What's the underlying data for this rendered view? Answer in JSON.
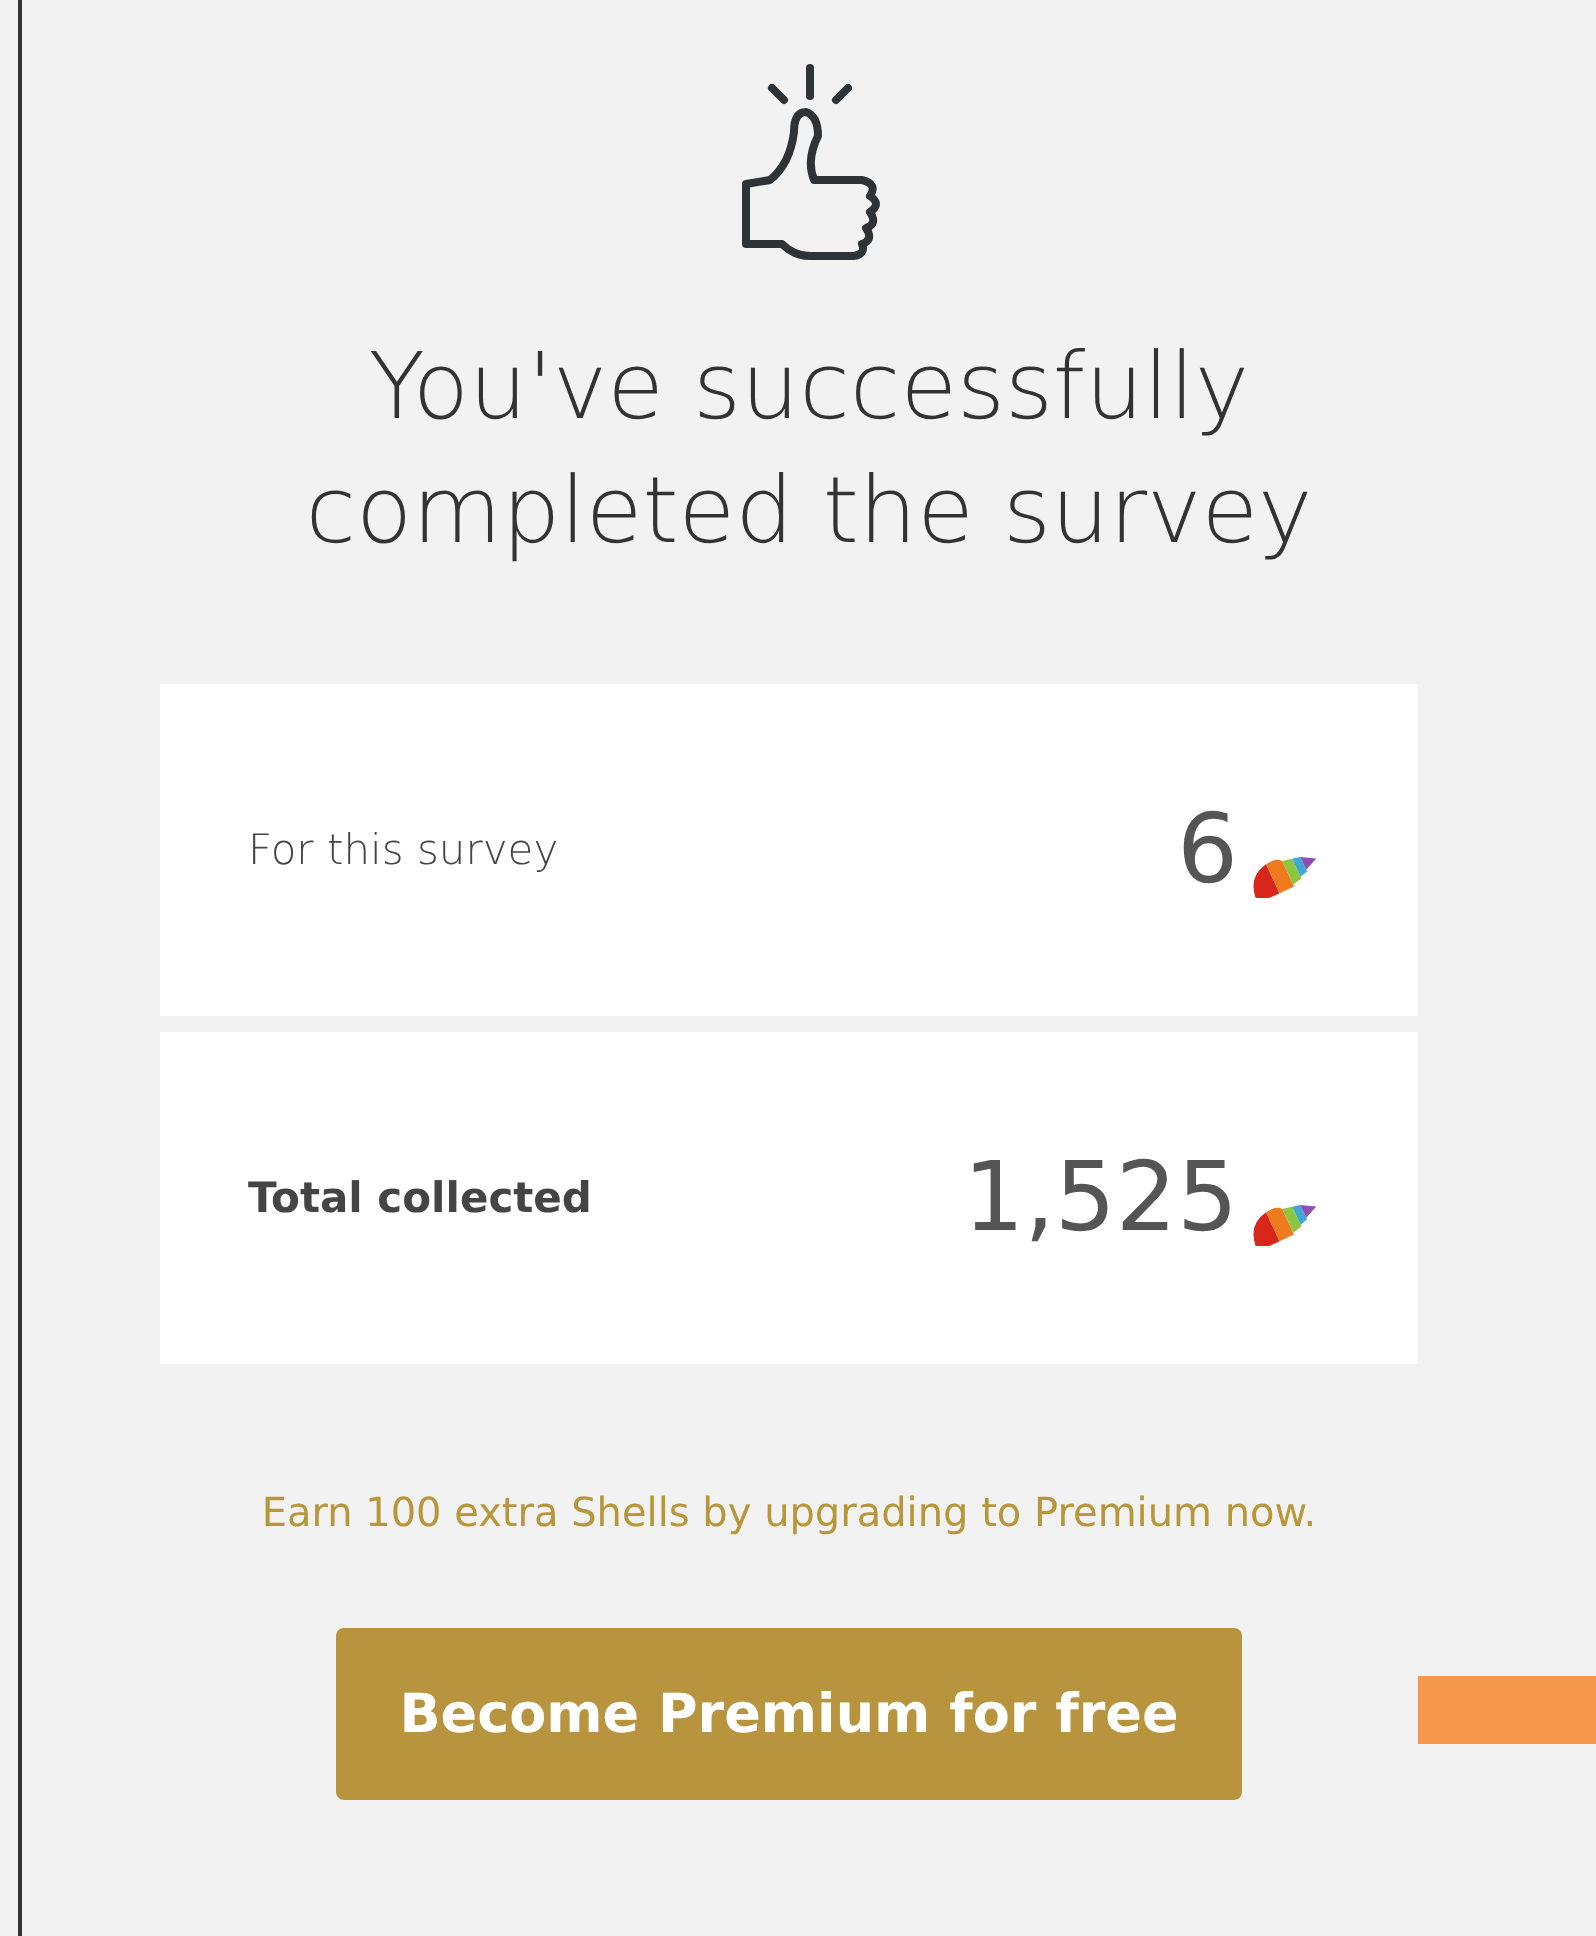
{
  "title": "You've successfully completed the survey",
  "rewards": [
    {
      "label": "For this survey",
      "value": "6",
      "emphasis": false
    },
    {
      "label": "Total collected",
      "value": "1,525",
      "emphasis": true
    }
  ],
  "promo": "Earn 100 extra Shells by upgrading to Premium now.",
  "button": "Become Premium for free"
}
